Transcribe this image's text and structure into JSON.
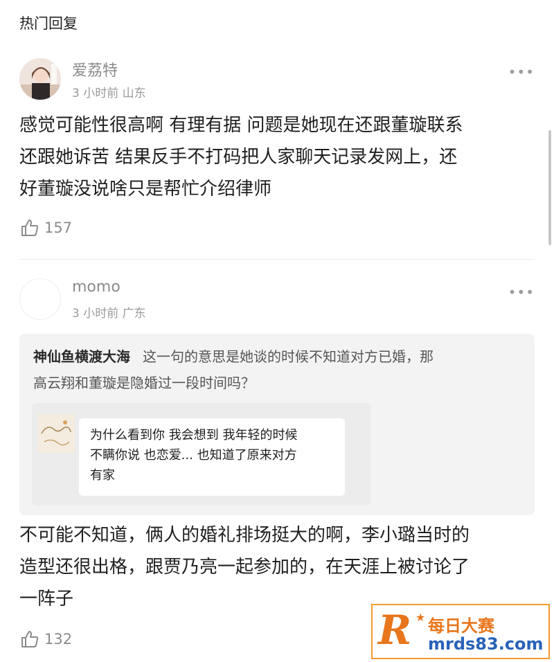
{
  "page": {
    "section_title": "热门回复"
  },
  "comments": [
    {
      "username": "爱荔特",
      "time": "3 小时前",
      "location": "山东",
      "more": "•••",
      "text_lines": [
        "感觉可能性很高啊 有理有据 问题是她现在还跟董璇联系",
        "还跟她诉苦 结果反手不打码把人家聊天记录发网上，还",
        "好董璇没说啥只是帮忙介绍律师"
      ],
      "likes": "157"
    },
    {
      "username": "momo",
      "time": "3 小时前",
      "location": "广东",
      "more": "•••",
      "quote": {
        "author": "神仙鱼横渡大海",
        "text_line1": "这一句的意思是她谈的时候不知道对方已婚，那",
        "text_line2": "高云翔和董璇是隐婚过一段时间吗？",
        "image_lines": [
          "为什么看到你 我会想到 我年轻的时候",
          "不瞒你说 也恋爱... 也知道了原来对方",
          "有家"
        ]
      },
      "text_lines": [
        "不可能不知道，俩人的婚礼排场挺大的啊，李小璐当时的",
        "造型还很出格，跟贾乃亮一起参加的，在天涯上被讨论了",
        "一阵子"
      ],
      "likes": "132"
    }
  ],
  "watermark": {
    "logo_letter": "R",
    "name": "每日大赛",
    "url": "mrds83.com"
  },
  "colors": {
    "accent_orange": "#e8761c",
    "watermark_blue": "#2962b8",
    "meta_gray": "#9a9a9a",
    "quote_background": "#f3f3f3"
  },
  "icons": [
    "more-icon",
    "thumbs-up-icon",
    "star-icon"
  ]
}
